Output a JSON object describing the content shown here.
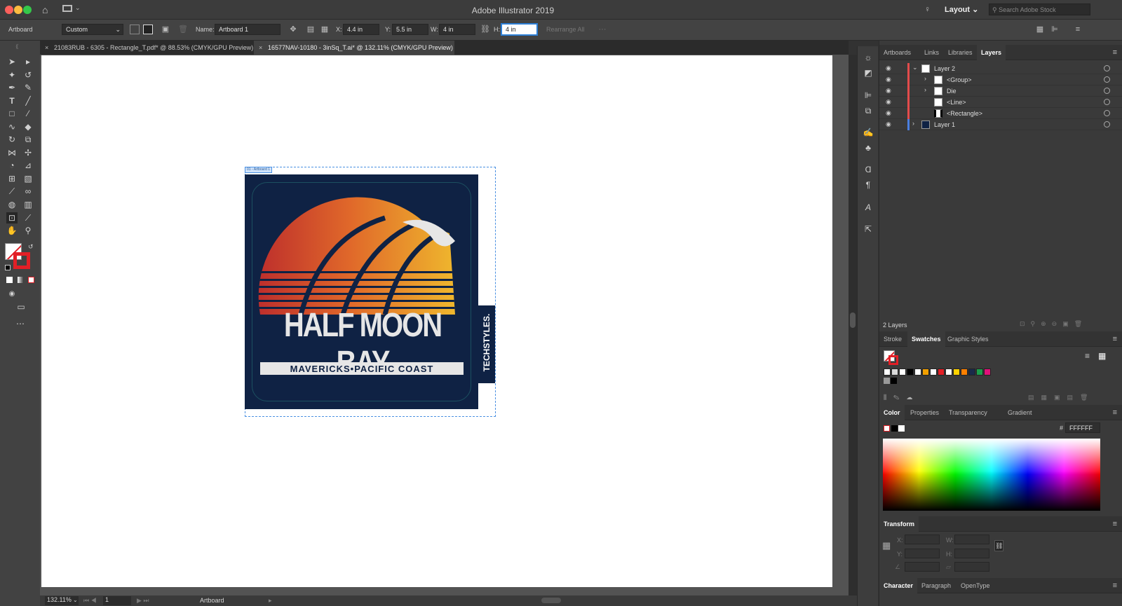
{
  "app": {
    "title": "Adobe Illustrator 2019",
    "workspace": "Layout",
    "search_placeholder": "Search Adobe Stock"
  },
  "control": {
    "tool_label": "Artboard",
    "preset": "Custom",
    "name_label": "Name:",
    "name_value": "Artboard 1",
    "x_label": "X:",
    "x_value": "4.4 in",
    "y_label": "Y:",
    "y_value": "5.5 in",
    "w_label": "W:",
    "w_value": "4 in",
    "h_label": "H:",
    "h_value": "4 in",
    "rearrange": "Rearrange All"
  },
  "tabs": [
    {
      "label": "21083RUB - 6305 - Rectangle_T.pdf* @ 88.53% (CMYK/GPU Preview)"
    },
    {
      "label": "16577NAV-10180 - 3inSq_T.ai* @ 132.11% (CMYK/GPU Preview)"
    }
  ],
  "artboard": {
    "label": "01 - Artboard 1"
  },
  "design": {
    "title": "HALF MOON BAY",
    "subtitle": "MAVERICKS•PACIFIC COAST",
    "brand": "TECHSTYLES."
  },
  "status": {
    "zoom": "132.11%",
    "page": "1",
    "tool": "Artboard"
  },
  "layers_panel": {
    "tabs": [
      "Artboards",
      "Links",
      "Libraries",
      "Layers"
    ],
    "rows": [
      {
        "name": "Layer 2"
      },
      {
        "name": "<Group>"
      },
      {
        "name": "Die"
      },
      {
        "name": "<Line>"
      },
      {
        "name": "<Rectangle>"
      },
      {
        "name": "Layer 1"
      }
    ],
    "count": "2 Layers"
  },
  "swatches_panel": {
    "tabs": [
      "Stroke",
      "Swatches",
      "Graphic Styles"
    ],
    "colors": [
      "#ffffff",
      "#d9d9d9",
      "#ffffff",
      "#000000",
      "#ffffff",
      "#f2a000",
      "#ffffff",
      "#e21f26",
      "#ffffff",
      "#ffd200",
      "#ff8000",
      "#1a2a4a",
      "#1b9e4b",
      "#e0117a"
    ]
  },
  "color_panel": {
    "tabs": [
      "Color",
      "Properties",
      "Transparency",
      "Gradient"
    ],
    "hex_label": "#",
    "hex_value": "FFFFFF"
  },
  "transform_panel": {
    "title": "Transform",
    "x": "X:",
    "y": "Y:",
    "w": "W:",
    "h": "H:"
  },
  "character_panel": {
    "tabs": [
      "Character",
      "Paragraph",
      "OpenType"
    ]
  },
  "colors": {
    "navy": "#0f2244",
    "chrome": "#323232",
    "accent": "#2d7fd6"
  }
}
